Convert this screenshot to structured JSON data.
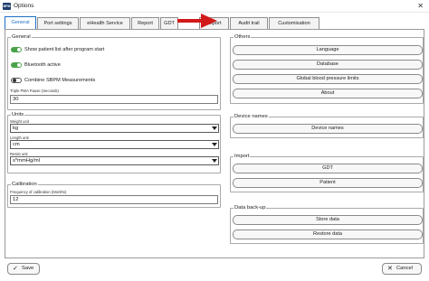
{
  "window": {
    "icon_text": "BPM",
    "title": "Options",
    "close_glyph": "✕"
  },
  "tabs": [
    {
      "label": "General",
      "active": true
    },
    {
      "label": "Port settings"
    },
    {
      "label": "eHealth Service"
    },
    {
      "label": "Report"
    },
    {
      "label": "GDT"
    },
    {
      "label": "Export"
    },
    {
      "label": "Audit trail"
    },
    {
      "label": "Customisation"
    }
  ],
  "general": {
    "legend": "General",
    "toggles": [
      {
        "label": "Show patient list after program start",
        "on": true
      },
      {
        "label": "Bluetooth active",
        "on": true
      },
      {
        "label": "Combine SBPM Measurements",
        "on": false
      }
    ],
    "pause_label": "Triple PWA Pause (Seconds)",
    "pause_value": "30"
  },
  "units": {
    "legend": "Units",
    "weight_label": "Weight unit",
    "weight_value": "kg",
    "length_label": "Length unit",
    "length_value": "cm",
    "resist_label": "Resist unit",
    "resist_value": "s*mmHg/ml"
  },
  "calibration": {
    "legend": "Calibration",
    "freq_label": "Frequency of calibration (Months)",
    "freq_value": "12"
  },
  "others": {
    "legend": "Others",
    "buttons": [
      "Language",
      "Database",
      "Global blood pressure limits",
      "About"
    ]
  },
  "device_names": {
    "legend": "Device names",
    "buttons": [
      "Device names"
    ]
  },
  "import": {
    "legend": "Import",
    "buttons": [
      "GDT",
      "Patient"
    ]
  },
  "backup": {
    "legend": "Data back-up",
    "buttons": [
      "Store data",
      "Restore data"
    ]
  },
  "footer": {
    "save_label": "Save",
    "cancel_label": "Cancel"
  },
  "colors": {
    "accent": "#1e6fc4",
    "toggle_on": "#4aa34a",
    "arrow": "#d11a1a"
  }
}
